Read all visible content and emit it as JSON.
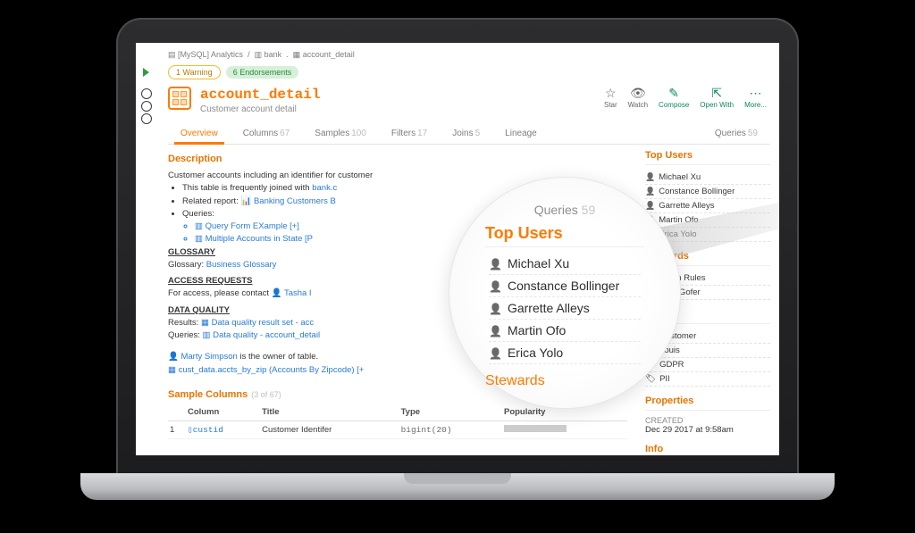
{
  "breadcrumb": {
    "db": "[MySQL] Analytics",
    "schema": "bank",
    "table": "account_detail"
  },
  "badges": {
    "warning": "1 Warning",
    "endorse": "6 Endorsements"
  },
  "asset": {
    "title": "account_detail",
    "subtitle": "Customer account detail"
  },
  "actions": {
    "star": "Star",
    "watch": "Watch",
    "compose": "Compose",
    "open": "Open With",
    "more": "More..."
  },
  "tabs": {
    "overview": "Overview",
    "columns": "Columns",
    "columns_ct": "67",
    "samples": "Samples",
    "samples_ct": "100",
    "filters": "Filters",
    "filters_ct": "17",
    "joins": "Joins",
    "joins_ct": "5",
    "lineage": "Lineage",
    "queries": "Queries",
    "queries_ct": "59"
  },
  "desc": {
    "heading": "Description",
    "intro": "Customer accounts including an identifier for customer",
    "bul1_pre": "This table is frequently joined with ",
    "bul1_link": "bank.c",
    "bul2_pre": "Related report: ",
    "bul2_link": "Banking Customers B",
    "bul3": "Queries:",
    "q1": "Query Form EXample  [+]",
    "q2": "Multiple Accounts in State [P",
    "glossary_h": "GLOSSARY",
    "glossary_link": "Business Glossary",
    "access_h": "ACCESS REQUESTS",
    "access_pre": "For access, please contact ",
    "access_link": "Tasha I",
    "dq_h": "DATA QUALITY",
    "dq_res_pre": "Results: ",
    "dq_res_link": "Data quality result set - acc",
    "dq_q_pre": "Queries: ",
    "dq_q_link": "Data quality - account_detail",
    "owner_link": "Marty Simpson",
    "owner_post": "  is the owner of table.",
    "lineage_link": "cust_data.accts_by_zip (Accounts By Zipcode) [+"
  },
  "side": {
    "topusers_h": "Top Users",
    "users": [
      "Michael Xu",
      "Constance Bollinger",
      "Garrette Alleys",
      "Martin Ofo",
      "Erica Yolo"
    ],
    "stewards_h": "Stewards",
    "stewards": [
      "Jason Rules",
      "Jake Gofer"
    ],
    "tags_h": "Tags",
    "tags": [
      "Customer",
      "Louis",
      "GDPR",
      "PII"
    ],
    "props_h": "Properties",
    "created_l": "CREATED",
    "created_v": "Dec 29 2017 at 9:58am",
    "info_h": "Info"
  },
  "samp": {
    "heading": "Sample Columns",
    "heading_ct": "(3 of 67)",
    "cols": {
      "idx": "",
      "col": "Column",
      "title": "Title",
      "type": "Type",
      "pop": "Popularity"
    },
    "row1": {
      "idx": "1",
      "col": "custid",
      "title": "Customer Identifer",
      "type": "bigint(20)"
    }
  },
  "lens": {
    "q": "Queries",
    "q_ct": "59",
    "h": "Top Users",
    "users": [
      "Michael Xu",
      "Constance Bollinger",
      "Garrette Alleys",
      "Martin Ofo",
      "Erica Yolo"
    ],
    "stw": "Stewards"
  }
}
